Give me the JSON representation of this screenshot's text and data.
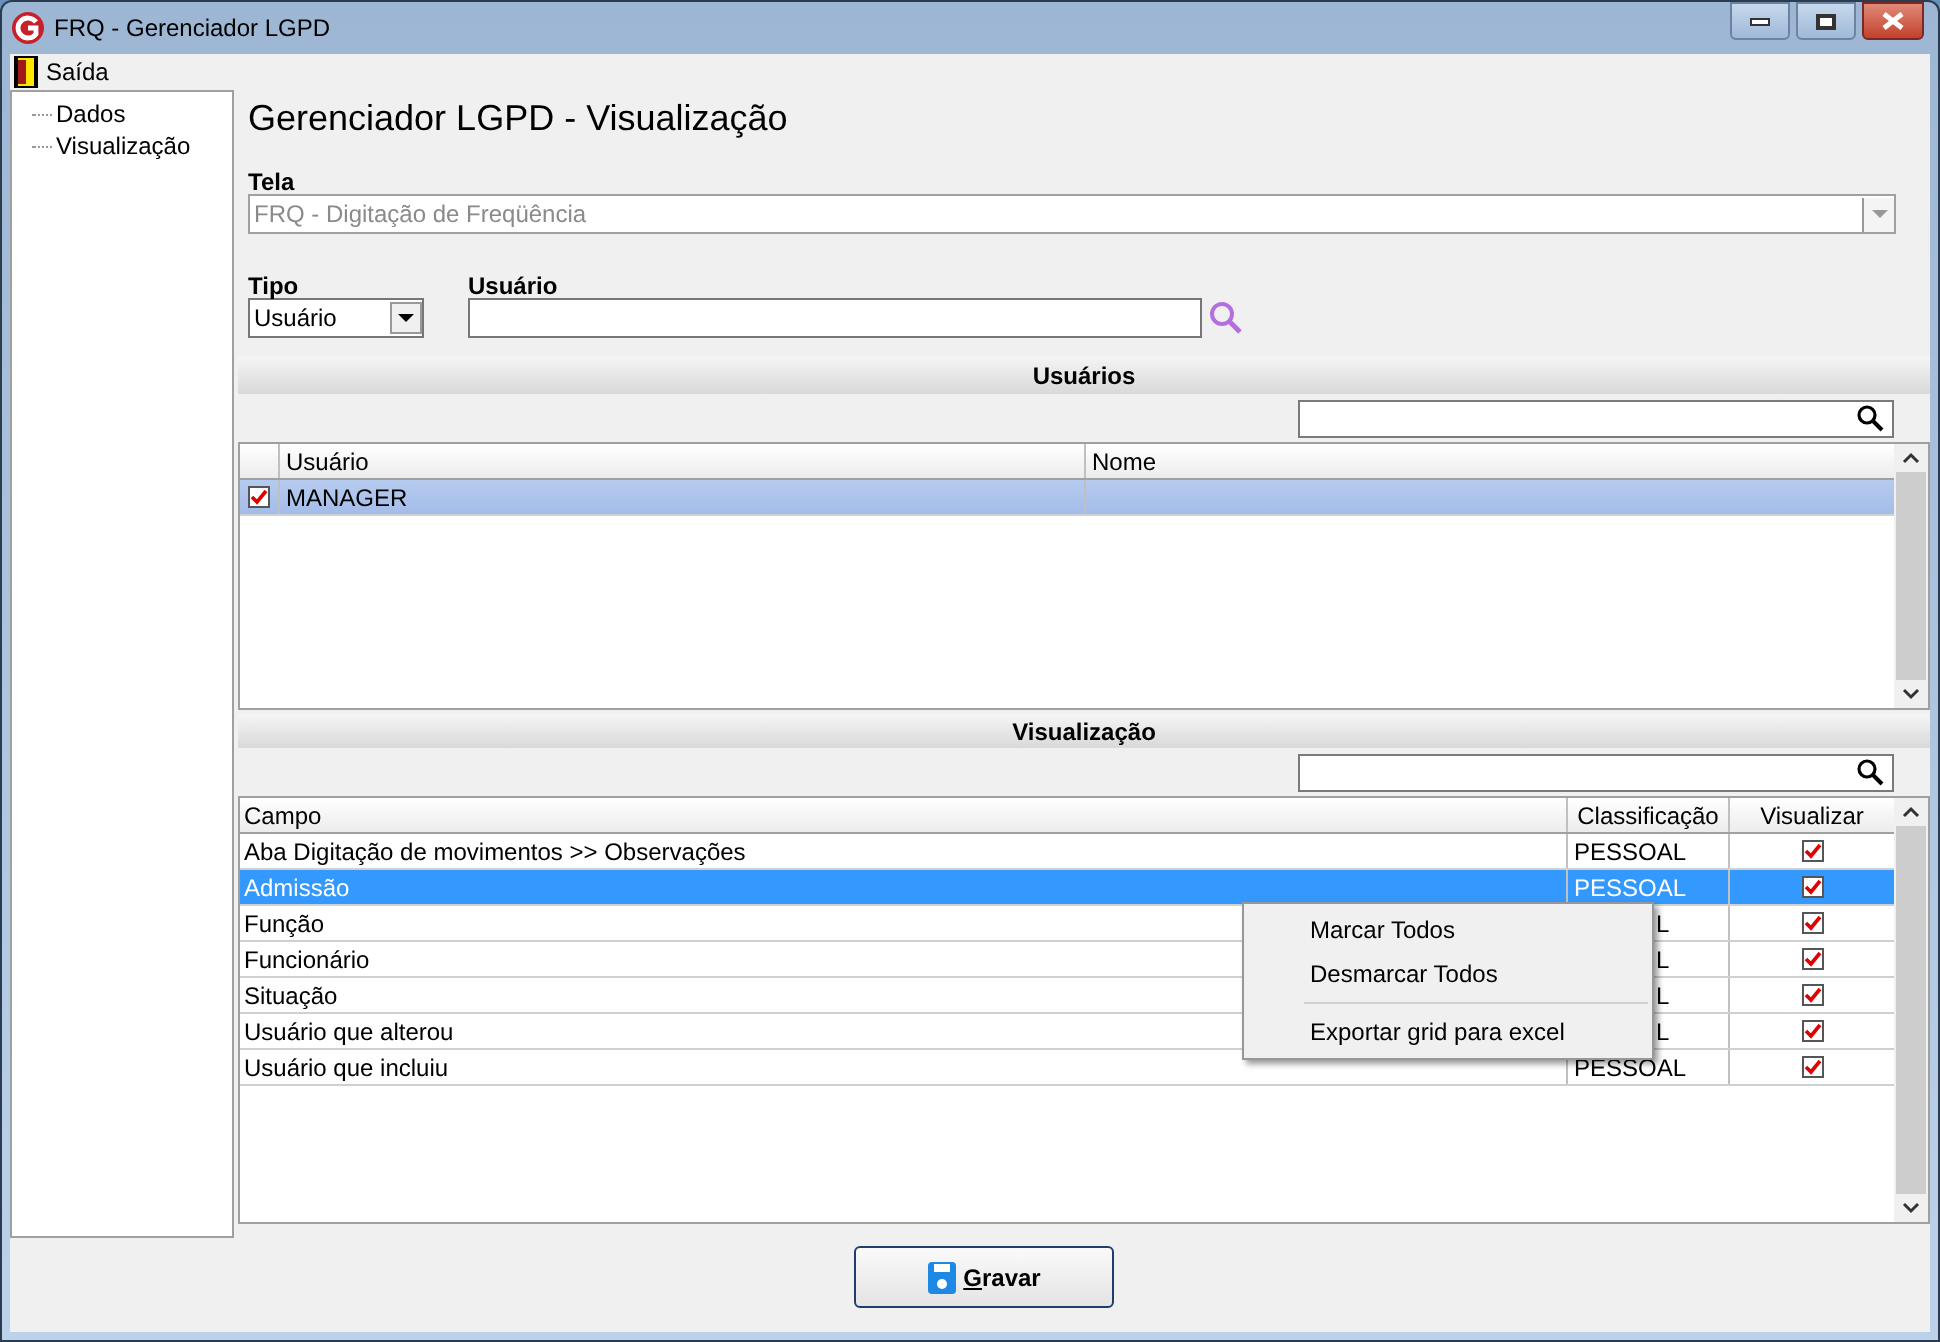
{
  "window": {
    "title": "FRQ - Gerenciador LGPD"
  },
  "menu": [
    {
      "label": "Saída"
    }
  ],
  "tree": [
    {
      "label": "Dados"
    },
    {
      "label": "Visualização"
    }
  ],
  "heading": "Gerenciador LGPD - Visualização",
  "tela": {
    "label": "Tela",
    "value": "FRQ - Digitação de Freqüência",
    "disabled": true
  },
  "tipo": {
    "label": "Tipo",
    "value": "Usuário"
  },
  "usuario": {
    "label": "Usuário"
  },
  "users_section": {
    "title": "Usuários",
    "columns": [
      "Usuário",
      "Nome"
    ],
    "rows": [
      {
        "checked": true,
        "selected": true,
        "cells": [
          "MANAGER"
        ]
      }
    ]
  },
  "view_section": {
    "title": "Visualização",
    "columns": [
      "Campo",
      "Classificação",
      "Visualizar"
    ],
    "rows": [
      {
        "campo": "Aba Digitação de movimentos >> Observações",
        "classificacao": "PESSOAL",
        "covered": false,
        "checked": true,
        "selected": false
      },
      {
        "campo": "Admissão",
        "classificacao": "PESSOAL",
        "covered": false,
        "checked": true,
        "selected": true
      },
      {
        "campo": "Função",
        "classificacao": "L",
        "covered": true,
        "checked": true,
        "selected": false
      },
      {
        "campo": "Funcionário",
        "classificacao": "L",
        "covered": true,
        "checked": true,
        "selected": false
      },
      {
        "campo": "Situação",
        "classificacao": "L",
        "covered": true,
        "checked": true,
        "selected": false
      },
      {
        "campo": "Usuário que alterou",
        "classificacao": "L",
        "covered": true,
        "checked": true,
        "selected": false
      },
      {
        "campo": "Usuário que incluiu",
        "classificacao": "PESSOAL",
        "covered": false,
        "checked": true,
        "selected": false
      }
    ]
  },
  "context_menu": [
    {
      "label": "Marcar Todos",
      "separator_before": false
    },
    {
      "label": "Desmarcar Todos",
      "separator_before": false
    },
    {
      "label": "Exportar grid para excel",
      "separator_before": true
    }
  ],
  "save_button": {
    "label": "Gravar"
  }
}
